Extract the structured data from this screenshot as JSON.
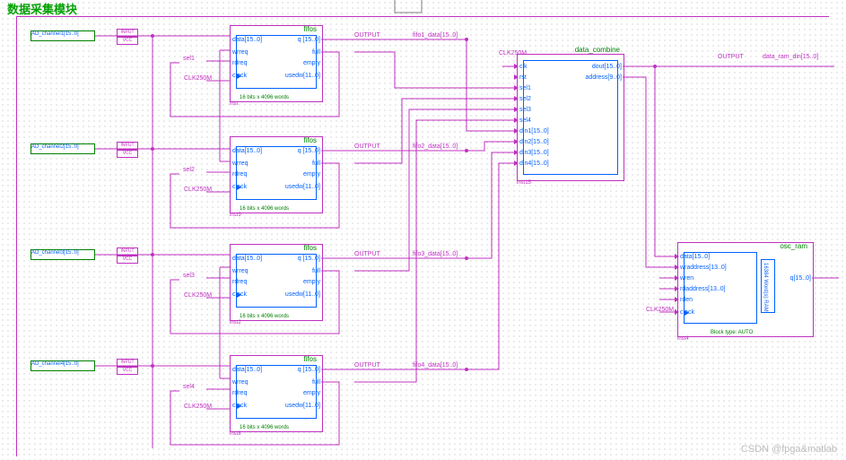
{
  "title": "数据采集模块",
  "watermark": "CSDN @fpga&matlab",
  "fifo": {
    "name": "fifos",
    "ports_left": [
      "data[15..0]",
      "wrreq",
      "rdreq",
      "clock"
    ],
    "ports_right": [
      "q [15..0]",
      "full",
      "empty",
      "usedw[11..0]"
    ],
    "footer": "16 bits x 4096 words",
    "inst": [
      "inst",
      "inst9",
      "inst2",
      "inst8"
    ]
  },
  "combine": {
    "name": "data_combine",
    "ports_left": [
      "clk",
      "rst",
      "sel1",
      "sel2",
      "sel3",
      "sel4",
      "din1[15..0]",
      "din2[15..0]",
      "din3[15..0]",
      "din4[15..0]"
    ],
    "ports_right": [
      "dout[15..0]",
      "address[9..0]"
    ],
    "inst": "inst15"
  },
  "ram": {
    "name": "osc_ram",
    "ports_left": [
      "data[15..0]",
      "wraddress[13..0]",
      "wren",
      "rdaddress[13..0]",
      "rden",
      "clock"
    ],
    "ports_right": [
      "q[15..0]"
    ],
    "footer": "Block type: AUTO",
    "core": "16384 Word(s) RAM",
    "inst": "inst4"
  },
  "inputs": {
    "ch1": "AD_channel1[15..0]",
    "ch2": "AD_channel2[15..0]",
    "ch3": "AD_channel3[15..0]",
    "ch4": "AD_channel4[15..0]"
  },
  "stubs": {
    "input": "INPUT",
    "vcc": "VCC"
  },
  "netlabels": {
    "clk": "CLK250M",
    "sel1": "sel1",
    "sel2": "sel2",
    "sel3": "sel3",
    "sel4": "sel4",
    "output": "OUTPUT",
    "fifo1": "fifo1_data[15..0]",
    "fifo2": "fifo2_data[15..0]",
    "fifo3": "fifo3_data[15..0]",
    "fifo4": "fifo4_data[15..0]",
    "ramdin": "data_ram_din[15..0]"
  }
}
